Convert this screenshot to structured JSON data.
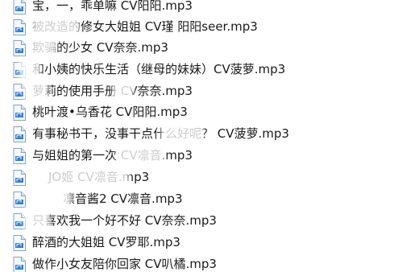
{
  "file_icon": "audio-file-icon",
  "accent_color": "#2f7fd6",
  "files": [
    {
      "name": "宝，一，乖单嘛 CV阳阳.mp3"
    },
    {
      "name": "被改造的修女大姐姐 CV瑾 阳阳seer.mp3"
    },
    {
      "name": "欺骗的少女 CV奈奈.mp3"
    },
    {
      "name": "和小姨的快乐生活（继母的妹妹）CV菠萝.mp3"
    },
    {
      "name": "萝莉的使用手册 CV奈奈.mp3"
    },
    {
      "name": "桃叶渡•乌香花 CV阳阳.mp3"
    },
    {
      "name": "有事秘书干，没事干点什么好呢？ CV菠萝.mp3"
    },
    {
      "name": "与姐姐的第一次 CV凛音.mp3"
    },
    {
      "name": "JO姬 CV凛音.mp3"
    },
    {
      "name": "凛音酱2 CV凛音.mp3"
    },
    {
      "name": "只喜欢我一个好不好 CV奈奈.mp3"
    },
    {
      "name": "醉酒的大姐姐 CV罗耶.mp3"
    },
    {
      "name": "做作小女友陪你回家 CV叭橘.mp3"
    }
  ]
}
